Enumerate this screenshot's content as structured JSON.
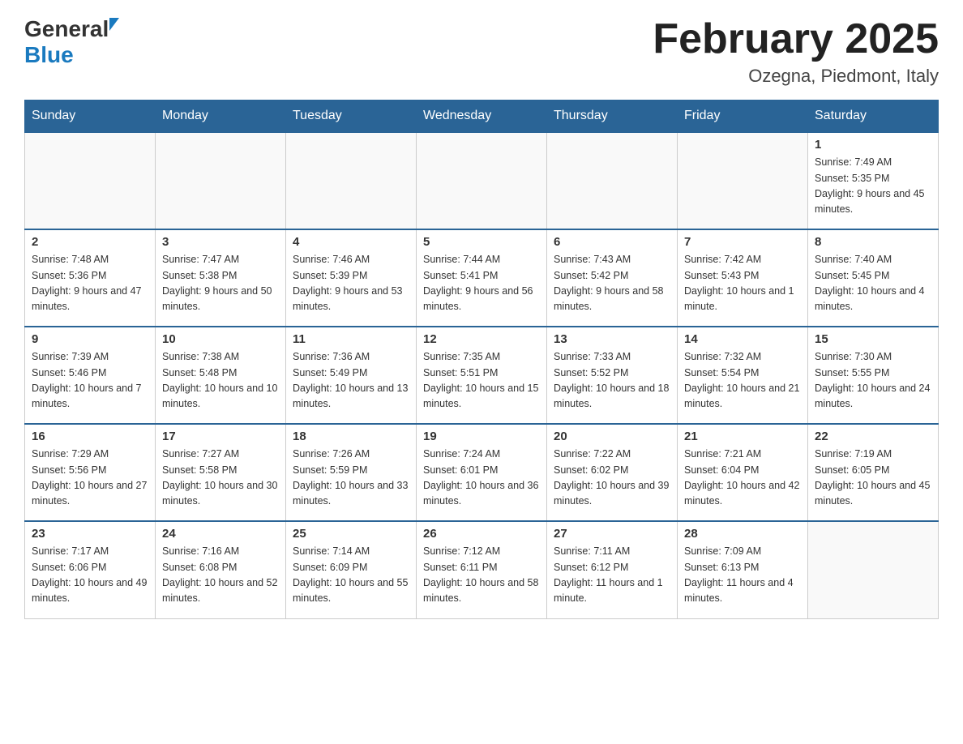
{
  "header": {
    "logo_general": "General",
    "logo_blue": "Blue",
    "month_title": "February 2025",
    "location": "Ozegna, Piedmont, Italy"
  },
  "days_of_week": [
    "Sunday",
    "Monday",
    "Tuesday",
    "Wednesday",
    "Thursday",
    "Friday",
    "Saturday"
  ],
  "weeks": [
    [
      {
        "day": "",
        "info": ""
      },
      {
        "day": "",
        "info": ""
      },
      {
        "day": "",
        "info": ""
      },
      {
        "day": "",
        "info": ""
      },
      {
        "day": "",
        "info": ""
      },
      {
        "day": "",
        "info": ""
      },
      {
        "day": "1",
        "info": "Sunrise: 7:49 AM\nSunset: 5:35 PM\nDaylight: 9 hours and 45 minutes."
      }
    ],
    [
      {
        "day": "2",
        "info": "Sunrise: 7:48 AM\nSunset: 5:36 PM\nDaylight: 9 hours and 47 minutes."
      },
      {
        "day": "3",
        "info": "Sunrise: 7:47 AM\nSunset: 5:38 PM\nDaylight: 9 hours and 50 minutes."
      },
      {
        "day": "4",
        "info": "Sunrise: 7:46 AM\nSunset: 5:39 PM\nDaylight: 9 hours and 53 minutes."
      },
      {
        "day": "5",
        "info": "Sunrise: 7:44 AM\nSunset: 5:41 PM\nDaylight: 9 hours and 56 minutes."
      },
      {
        "day": "6",
        "info": "Sunrise: 7:43 AM\nSunset: 5:42 PM\nDaylight: 9 hours and 58 minutes."
      },
      {
        "day": "7",
        "info": "Sunrise: 7:42 AM\nSunset: 5:43 PM\nDaylight: 10 hours and 1 minute."
      },
      {
        "day": "8",
        "info": "Sunrise: 7:40 AM\nSunset: 5:45 PM\nDaylight: 10 hours and 4 minutes."
      }
    ],
    [
      {
        "day": "9",
        "info": "Sunrise: 7:39 AM\nSunset: 5:46 PM\nDaylight: 10 hours and 7 minutes."
      },
      {
        "day": "10",
        "info": "Sunrise: 7:38 AM\nSunset: 5:48 PM\nDaylight: 10 hours and 10 minutes."
      },
      {
        "day": "11",
        "info": "Sunrise: 7:36 AM\nSunset: 5:49 PM\nDaylight: 10 hours and 13 minutes."
      },
      {
        "day": "12",
        "info": "Sunrise: 7:35 AM\nSunset: 5:51 PM\nDaylight: 10 hours and 15 minutes."
      },
      {
        "day": "13",
        "info": "Sunrise: 7:33 AM\nSunset: 5:52 PM\nDaylight: 10 hours and 18 minutes."
      },
      {
        "day": "14",
        "info": "Sunrise: 7:32 AM\nSunset: 5:54 PM\nDaylight: 10 hours and 21 minutes."
      },
      {
        "day": "15",
        "info": "Sunrise: 7:30 AM\nSunset: 5:55 PM\nDaylight: 10 hours and 24 minutes."
      }
    ],
    [
      {
        "day": "16",
        "info": "Sunrise: 7:29 AM\nSunset: 5:56 PM\nDaylight: 10 hours and 27 minutes."
      },
      {
        "day": "17",
        "info": "Sunrise: 7:27 AM\nSunset: 5:58 PM\nDaylight: 10 hours and 30 minutes."
      },
      {
        "day": "18",
        "info": "Sunrise: 7:26 AM\nSunset: 5:59 PM\nDaylight: 10 hours and 33 minutes."
      },
      {
        "day": "19",
        "info": "Sunrise: 7:24 AM\nSunset: 6:01 PM\nDaylight: 10 hours and 36 minutes."
      },
      {
        "day": "20",
        "info": "Sunrise: 7:22 AM\nSunset: 6:02 PM\nDaylight: 10 hours and 39 minutes."
      },
      {
        "day": "21",
        "info": "Sunrise: 7:21 AM\nSunset: 6:04 PM\nDaylight: 10 hours and 42 minutes."
      },
      {
        "day": "22",
        "info": "Sunrise: 7:19 AM\nSunset: 6:05 PM\nDaylight: 10 hours and 45 minutes."
      }
    ],
    [
      {
        "day": "23",
        "info": "Sunrise: 7:17 AM\nSunset: 6:06 PM\nDaylight: 10 hours and 49 minutes."
      },
      {
        "day": "24",
        "info": "Sunrise: 7:16 AM\nSunset: 6:08 PM\nDaylight: 10 hours and 52 minutes."
      },
      {
        "day": "25",
        "info": "Sunrise: 7:14 AM\nSunset: 6:09 PM\nDaylight: 10 hours and 55 minutes."
      },
      {
        "day": "26",
        "info": "Sunrise: 7:12 AM\nSunset: 6:11 PM\nDaylight: 10 hours and 58 minutes."
      },
      {
        "day": "27",
        "info": "Sunrise: 7:11 AM\nSunset: 6:12 PM\nDaylight: 11 hours and 1 minute."
      },
      {
        "day": "28",
        "info": "Sunrise: 7:09 AM\nSunset: 6:13 PM\nDaylight: 11 hours and 4 minutes."
      },
      {
        "day": "",
        "info": ""
      }
    ]
  ]
}
